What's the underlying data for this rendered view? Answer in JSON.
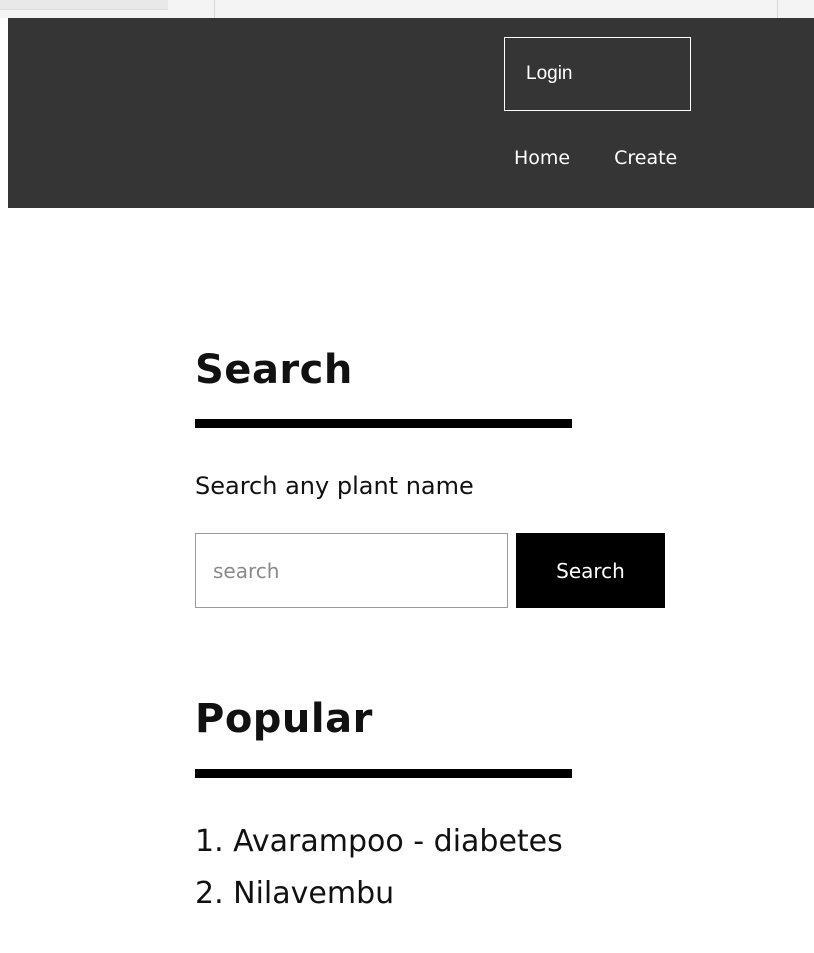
{
  "header": {
    "login_label": "Login",
    "nav": [
      {
        "label": "Home"
      },
      {
        "label": "Create"
      }
    ]
  },
  "search": {
    "title": "Search",
    "hint": "Search any plant name",
    "placeholder": "search",
    "button_label": "Search"
  },
  "popular": {
    "title": "Popular",
    "items": [
      {
        "label": "1. Avarampoo - diabetes"
      },
      {
        "label": "2. Nilavembu"
      }
    ]
  },
  "colors": {
    "header_bg": "#353535",
    "button_bg": "#000000",
    "rule": "#000000",
    "text": "#111111"
  }
}
